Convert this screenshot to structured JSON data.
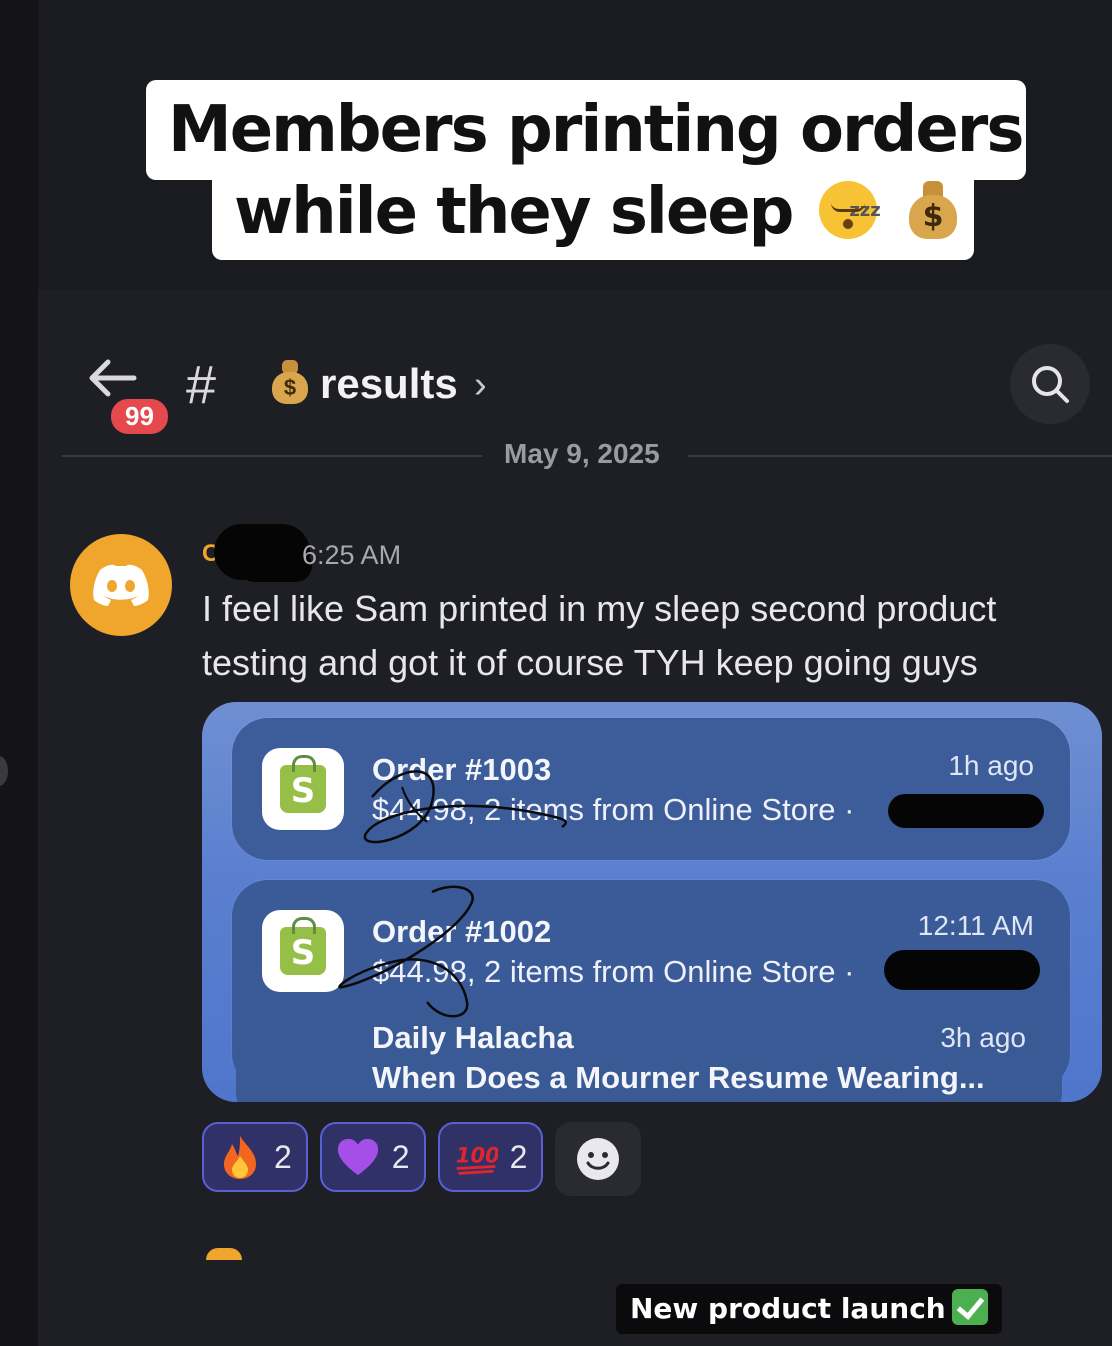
{
  "caption": {
    "line1": "Members printing orders",
    "line2": "while they sleep"
  },
  "header": {
    "unread_badge": "99",
    "channel_name": "results",
    "chevron": "›"
  },
  "date_divider": "May 9, 2025",
  "message": {
    "author_initial": "C",
    "timestamp": "6:25 AM",
    "text": "I feel like Sam printed in my sleep second product testing and got it of course TYH keep going guys"
  },
  "embed": {
    "notifications": [
      {
        "title": "Order #1003",
        "body": "$44.98, 2 items from Online Store ·",
        "time": "1h ago"
      },
      {
        "title": "Order #1002",
        "body": "$44.98, 2 items from Online Store ·",
        "time": "12:11 AM"
      }
    ],
    "stacked": {
      "title": "Daily Halacha",
      "body": "When Does a Mourner Resume Wearing...",
      "time": "3h ago"
    }
  },
  "reactions": [
    {
      "emoji": "fire-emoji",
      "count": "2"
    },
    {
      "emoji": "purple-heart-emoji",
      "count": "2"
    },
    {
      "emoji": "hundred-points-emoji",
      "count": "2"
    }
  ],
  "bottom_caption": "New product launch",
  "colors": {
    "accent": "#5a5fd6",
    "badge": "#e5484d",
    "avatar": "#f0a52d",
    "shopify": "#95bf47"
  }
}
